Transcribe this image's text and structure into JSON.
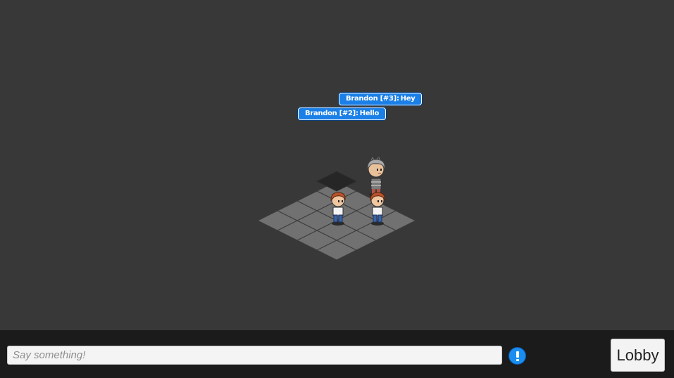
{
  "chat": {
    "messages": [
      {
        "user": "Brandon [#3]",
        "text": "Hey"
      },
      {
        "user": "Brandon [#2]",
        "text": "Hello"
      }
    ],
    "input_placeholder": "Say something!",
    "input_value": ""
  },
  "controls": {
    "info_icon": "exclamation-circle-icon",
    "lobby_label": "Lobby"
  },
  "colors": {
    "background": "#383838",
    "bottom_bar": "#1b1b1b",
    "bubble": "#1a7fe6",
    "tile": "#717171",
    "tile_border": "#3c3c3c",
    "door_tile": "#262626",
    "info_button": "#1a8ef0"
  },
  "room": {
    "avatars": [
      {
        "name": "gray-haired-avatar"
      },
      {
        "name": "red-haired-avatar-left"
      },
      {
        "name": "red-haired-avatar-right"
      }
    ]
  }
}
